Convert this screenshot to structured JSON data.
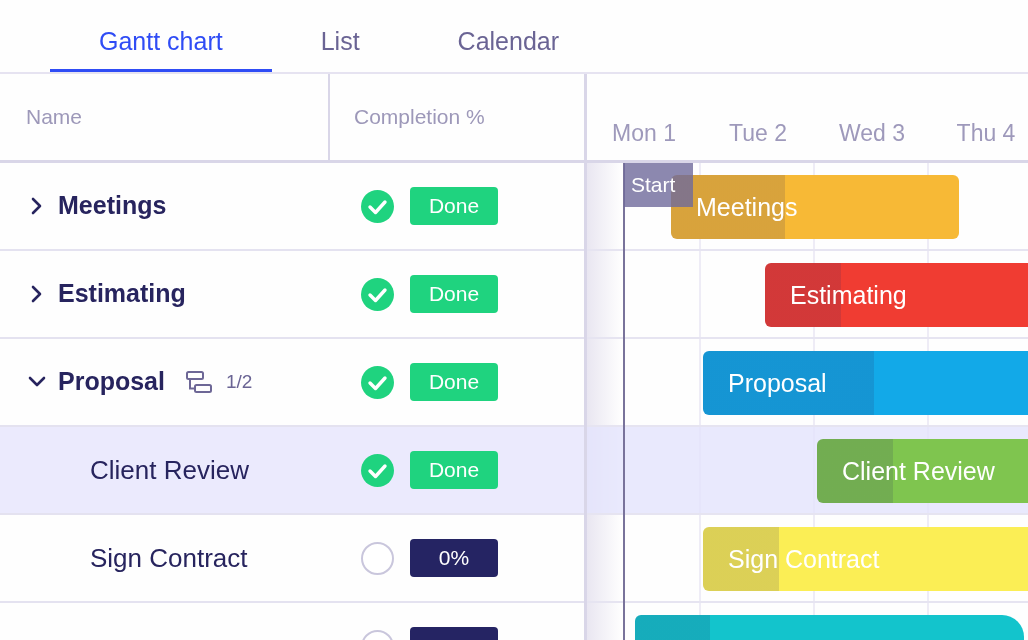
{
  "tabs": [
    {
      "label": "Gantt chart",
      "selected": true
    },
    {
      "label": "List",
      "selected": false
    },
    {
      "label": "Calendar",
      "selected": false
    }
  ],
  "table": {
    "columns": [
      {
        "label": "Name"
      },
      {
        "label": "Completion %"
      }
    ],
    "rows": [
      {
        "name": "Meetings",
        "expanded": false,
        "done": true,
        "status": "Done",
        "selected": false,
        "bar_label": "Meetings",
        "color": "#f7b936"
      },
      {
        "name": "Estimating",
        "expanded": false,
        "done": true,
        "status": "Done",
        "selected": false,
        "bar_label": "Estimating",
        "color": "#f03c32"
      },
      {
        "name": "Proposal",
        "expanded": true,
        "subtasks": "1/2",
        "done": true,
        "status": "Done",
        "selected": false,
        "bar_label": "Proposal",
        "color": "#12a9e8",
        "children": [
          {
            "name": "Client Review",
            "done": true,
            "status": "Done",
            "selected": true,
            "bar_label": "Client Review",
            "color": "#7fc54f"
          },
          {
            "name": "Sign Contract",
            "done": false,
            "status": "0%",
            "selected": false,
            "bar_label": "Sign Contract",
            "color": "#fbee55"
          }
        ]
      },
      {
        "done": false,
        "selected": false,
        "color": "#13c4cc"
      }
    ]
  },
  "timeline": {
    "days": [
      "Mon 1",
      "Tue 2",
      "Wed 3",
      "Thu 4"
    ],
    "marker": "Start"
  }
}
